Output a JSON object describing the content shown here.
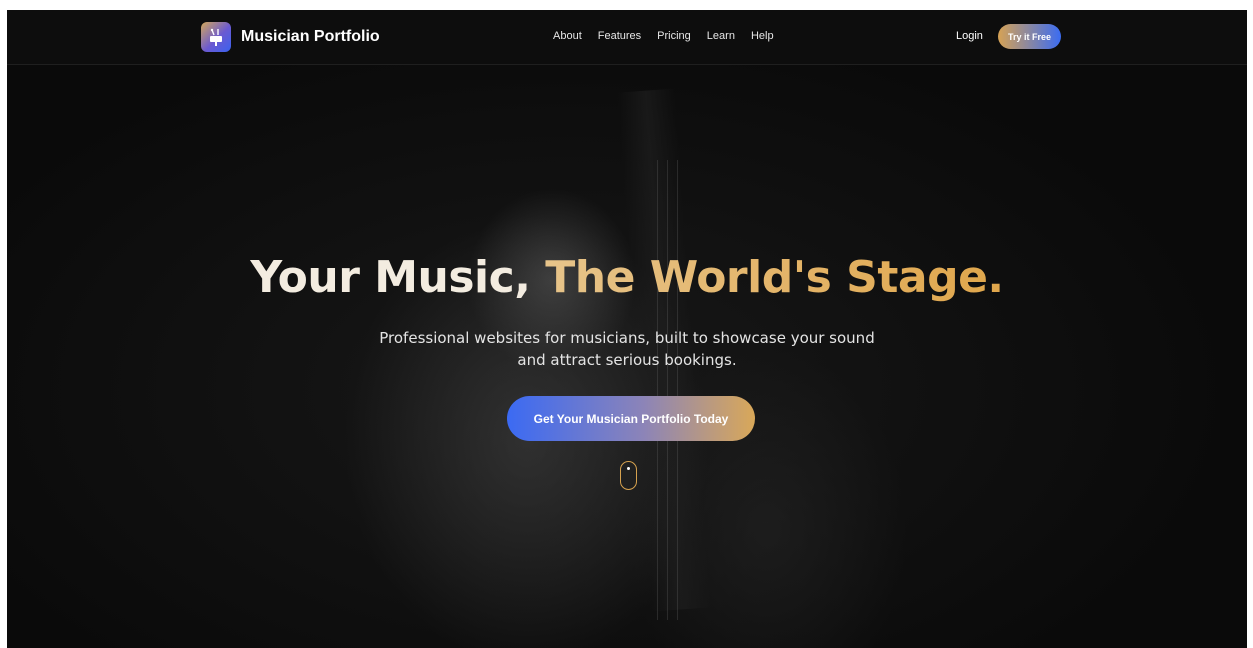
{
  "nav": {
    "brand_name": "Musician Portfolio",
    "links": [
      "About",
      "Features",
      "Pricing",
      "Learn",
      "Help"
    ],
    "login_label": "Login",
    "try_label": "Try it Free"
  },
  "hero": {
    "title_part1": "Your Music, ",
    "title_part2": "The World's Stage.",
    "subtitle": "Professional websites for musicians, built to showcase your sound and attract serious bookings.",
    "cta_label": "Get Your Musician Portfolio Today"
  },
  "icons": {
    "logo": "music-stand-icon",
    "scroll": "mouse-scroll-icon"
  },
  "colors": {
    "background": "#0b0b0b",
    "gold_accent": "#e0a64b",
    "blue_accent": "#3b6af3",
    "title_light": "#f3ece0"
  }
}
